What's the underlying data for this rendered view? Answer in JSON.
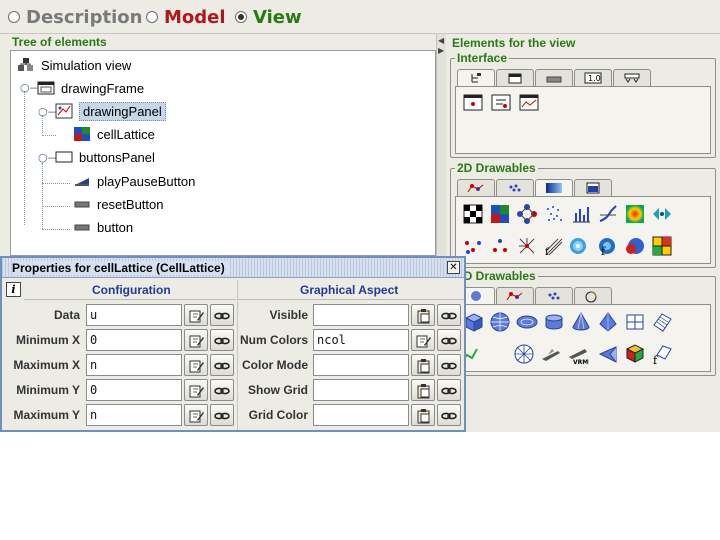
{
  "modes": {
    "description": "Description",
    "model": "Model",
    "view": "View",
    "selected": "View",
    "colors": {
      "description": "#7a7a7a",
      "model": "#b2151b",
      "view": "#2a7a14"
    }
  },
  "tree": {
    "title": "Tree of elements",
    "nodes": [
      {
        "label": "Simulation view",
        "icon": "simulation-view-icon"
      },
      {
        "label": "drawingFrame",
        "icon": "frame-icon"
      },
      {
        "label": "drawingPanel",
        "icon": "drawing-panel-icon",
        "selected": true
      },
      {
        "label": "cellLattice",
        "icon": "cell-lattice-icon"
      },
      {
        "label": "buttonsPanel",
        "icon": "panel-icon"
      },
      {
        "label": "playPauseButton",
        "icon": "two-state-button-icon"
      },
      {
        "label": "resetButton",
        "icon": "button-icon"
      },
      {
        "label": "button",
        "icon": "button-icon"
      }
    ]
  },
  "palette": {
    "title": "Elements for the view",
    "groups": {
      "interface": "Interface",
      "drawables2d": "2D Drawables",
      "drawables3d": "3D Drawables"
    },
    "interface_tab4_label": "1.0"
  },
  "properties": {
    "title": "Properties for cellLattice (CellLattice)",
    "config_header": "Configuration",
    "graphics_header": "Graphical Aspect",
    "info_icon": "i",
    "config": [
      {
        "label": "Data",
        "value": "u"
      },
      {
        "label": "Minimum X",
        "value": "0"
      },
      {
        "label": "Maximum X",
        "value": "n"
      },
      {
        "label": "Minimum Y",
        "value": "0"
      },
      {
        "label": "Maximum Y",
        "value": "n"
      }
    ],
    "graphics": [
      {
        "label": "Visible",
        "value": ""
      },
      {
        "label": "Num Colors",
        "value": "ncol"
      },
      {
        "label": "Color Mode",
        "value": ""
      },
      {
        "label": "Show Grid",
        "value": ""
      },
      {
        "label": "Grid Color",
        "value": ""
      }
    ]
  },
  "accent_colors": {
    "header_green": "#2a7a14",
    "props_blue": "#1d3c9a",
    "dialog_border": "#6f8fbd"
  }
}
